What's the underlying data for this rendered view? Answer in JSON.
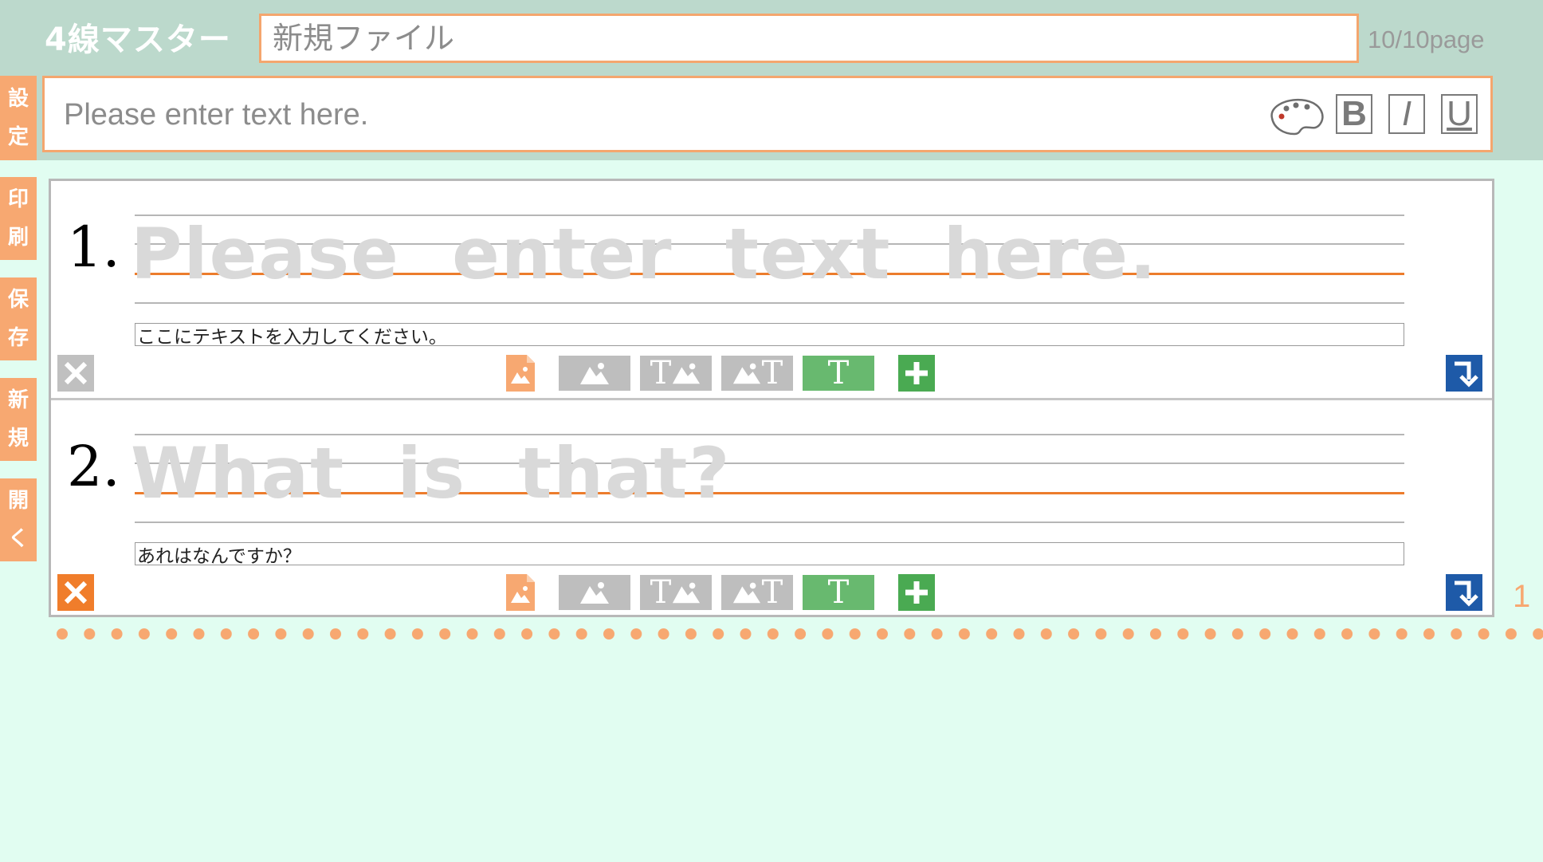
{
  "header": {
    "app_title": "4線マスター",
    "file_name_placeholder": "新規ファイル",
    "page_counter": "10/10page"
  },
  "sidebar": {
    "items": [
      {
        "label": "設定",
        "chars": [
          "設",
          "定"
        ]
      },
      {
        "label": "印刷",
        "chars": [
          "印",
          "刷"
        ]
      },
      {
        "label": "保存",
        "chars": [
          "保",
          "存"
        ]
      },
      {
        "label": "新規",
        "chars": [
          "新",
          "規"
        ]
      },
      {
        "label": "開く",
        "chars": [
          "開",
          "く"
        ]
      }
    ]
  },
  "editor": {
    "placeholder": "Please enter text here.",
    "bold_label": "B",
    "italic_label": "I",
    "underline_label": "U",
    "palette_icon": "palette-icon"
  },
  "rows": [
    {
      "number": "1.",
      "trace_text": "Please  enter  text  here.",
      "sentence": "ここにテキストを入力してください。",
      "delete_state": "disabled"
    },
    {
      "number": "2.",
      "trace_text": "What  is  that?",
      "sentence": "あれはなんですか？",
      "delete_state": "enabled"
    }
  ],
  "toolbar": {
    "layout_text_glyph": "T"
  },
  "page_number": "1",
  "colors": {
    "header_bg": "#bcd9cc",
    "page_bg": "#e1fdf1",
    "accent_orange": "#f7a871",
    "baseline_orange": "#ec7c2c",
    "active_green": "#68b96f",
    "add_green": "#4aaa52",
    "move_blue": "#1e5aa8",
    "inactive_gray": "#bebebe"
  }
}
